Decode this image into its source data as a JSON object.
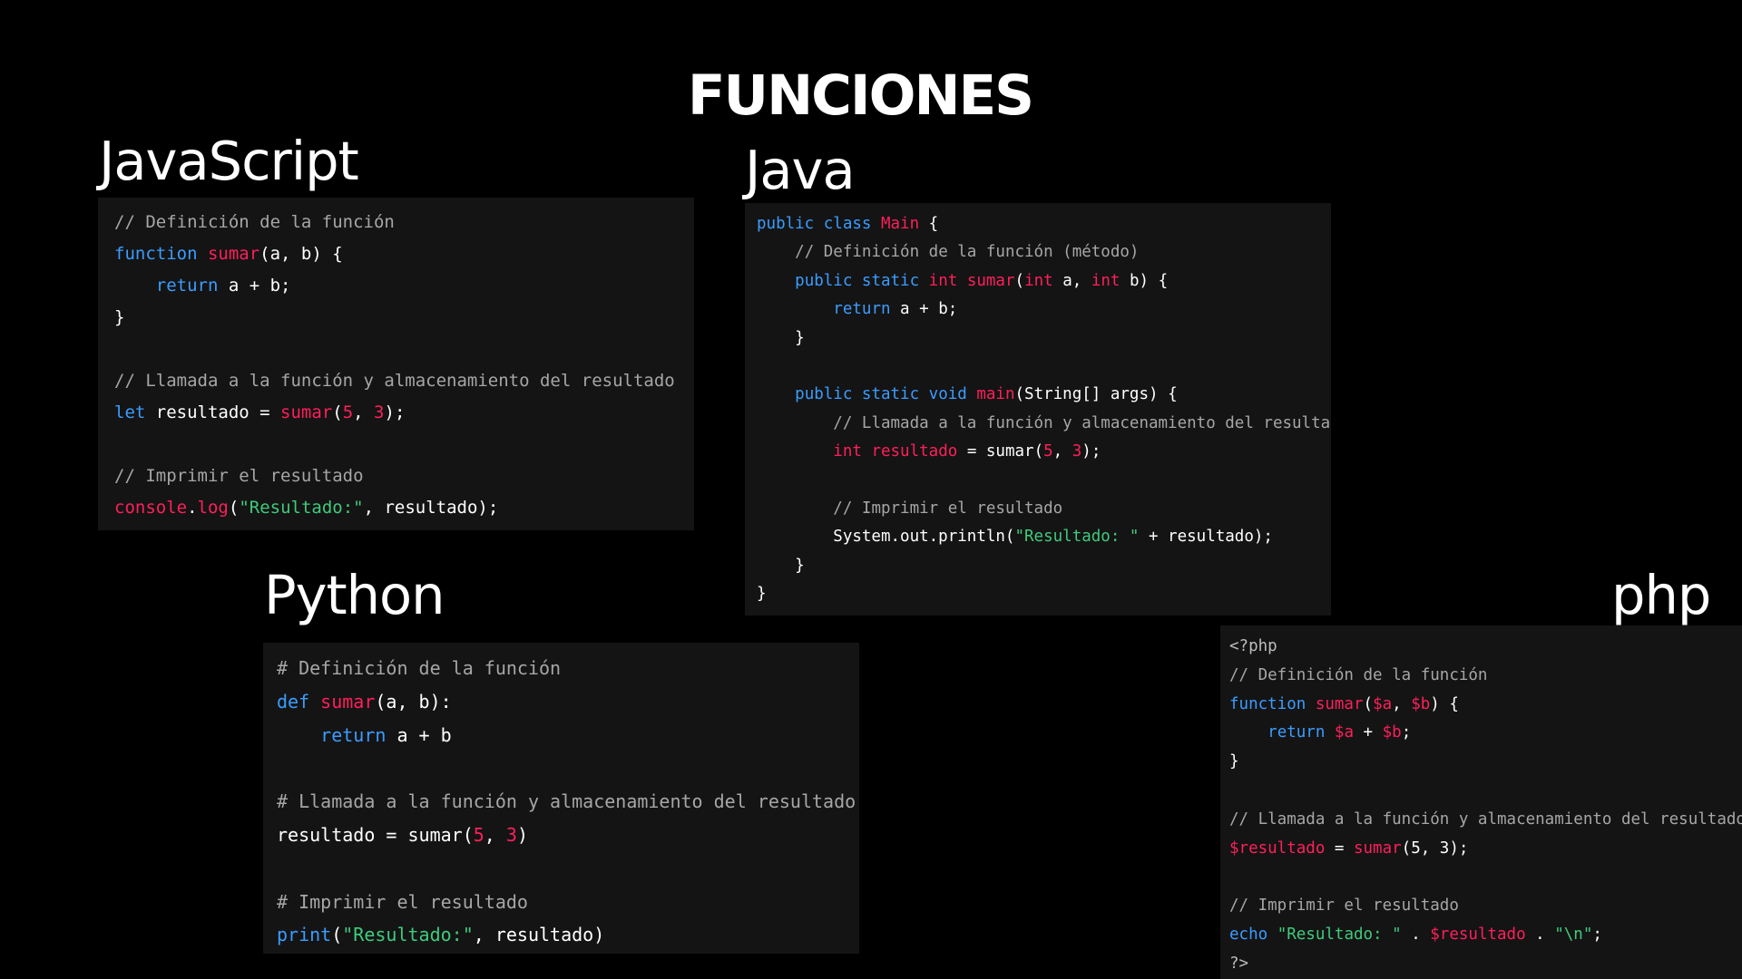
{
  "slide": {
    "title": "FUNCIONES"
  },
  "colors": {
    "background": "#000000",
    "code_background": "#141414",
    "comment": "#a6a6a6",
    "keyword": "#3b9cff",
    "function_name": "#ff1f5a",
    "string": "#3ecb7c",
    "text": "#ffffff"
  },
  "blocks": {
    "javascript": {
      "heading": "JavaScript",
      "lines": [
        [
          [
            "cm",
            "// Definición de la función"
          ]
        ],
        [
          [
            "kw",
            "function "
          ],
          [
            "fn",
            "sumar"
          ],
          [
            "pl",
            "(a, b) {"
          ]
        ],
        [
          [
            "pl",
            "    "
          ],
          [
            "kw",
            "return"
          ],
          [
            "pl",
            " a + b;"
          ]
        ],
        [
          [
            "pl",
            "}"
          ]
        ],
        [],
        [
          [
            "cm",
            "// Llamada a la función y almacenamiento del resultado"
          ]
        ],
        [
          [
            "kw",
            "let"
          ],
          [
            "pl",
            " resultado = "
          ],
          [
            "fn",
            "sumar"
          ],
          [
            "pl",
            "("
          ],
          [
            "nu",
            "5"
          ],
          [
            "pl",
            ", "
          ],
          [
            "nu",
            "3"
          ],
          [
            "pl",
            ");"
          ]
        ],
        [],
        [
          [
            "cm",
            "// Imprimir el resultado"
          ]
        ],
        [
          [
            "fn",
            "console"
          ],
          [
            "pl",
            "."
          ],
          [
            "fn",
            "log"
          ],
          [
            "pl",
            "("
          ],
          [
            "st",
            "\"Resultado:\""
          ],
          [
            "pl",
            ", resultado);"
          ]
        ]
      ]
    },
    "java": {
      "heading": "Java",
      "lines": [
        [
          [
            "kw",
            "public class "
          ],
          [
            "fn",
            "Main"
          ],
          [
            "pl",
            " {"
          ]
        ],
        [
          [
            "pl",
            "    "
          ],
          [
            "cm",
            "// Definición de la función (método)"
          ]
        ],
        [
          [
            "pl",
            "    "
          ],
          [
            "kw",
            "public static "
          ],
          [
            "ty",
            "int "
          ],
          [
            "fn",
            "sumar"
          ],
          [
            "pl",
            "("
          ],
          [
            "ty",
            "int"
          ],
          [
            "pl",
            " a, "
          ],
          [
            "ty",
            "int"
          ],
          [
            "pl",
            " b) {"
          ]
        ],
        [
          [
            "pl",
            "        "
          ],
          [
            "kw",
            "return"
          ],
          [
            "pl",
            " a + b;"
          ]
        ],
        [
          [
            "pl",
            "    }"
          ]
        ],
        [],
        [
          [
            "pl",
            "    "
          ],
          [
            "kw",
            "public static void "
          ],
          [
            "fn",
            "main"
          ],
          [
            "pl",
            "(String[] args) {"
          ]
        ],
        [
          [
            "pl",
            "        "
          ],
          [
            "cm",
            "// Llamada a la función y almacenamiento del resultado"
          ]
        ],
        [
          [
            "pl",
            "        "
          ],
          [
            "ty",
            "int "
          ],
          [
            "va",
            "resultado"
          ],
          [
            "pl",
            " = sumar("
          ],
          [
            "nu",
            "5"
          ],
          [
            "pl",
            ", "
          ],
          [
            "nu",
            "3"
          ],
          [
            "pl",
            ");"
          ]
        ],
        [],
        [
          [
            "pl",
            "        "
          ],
          [
            "cm",
            "// Imprimir el resultado"
          ]
        ],
        [
          [
            "pl",
            "        System.out.println("
          ],
          [
            "st",
            "\"Resultado: \""
          ],
          [
            "pl",
            " + resultado);"
          ]
        ],
        [
          [
            "pl",
            "    }"
          ]
        ],
        [
          [
            "pl",
            "}"
          ]
        ]
      ]
    },
    "python": {
      "heading": "Python",
      "lines": [
        [
          [
            "cm",
            "# Definición de la función"
          ]
        ],
        [
          [
            "kw",
            "def "
          ],
          [
            "fn",
            "sumar"
          ],
          [
            "pl",
            "(a, b):"
          ]
        ],
        [
          [
            "pl",
            "    "
          ],
          [
            "kw",
            "return"
          ],
          [
            "pl",
            " a + b"
          ]
        ],
        [],
        [
          [
            "cm",
            "# Llamada a la función y almacenamiento del resultado"
          ]
        ],
        [
          [
            "pl",
            "resultado = sumar("
          ],
          [
            "nu",
            "5"
          ],
          [
            "pl",
            ", "
          ],
          [
            "nu",
            "3"
          ],
          [
            "pl",
            ")"
          ]
        ],
        [],
        [
          [
            "cm",
            "# Imprimir el resultado"
          ]
        ],
        [
          [
            "kw",
            "print"
          ],
          [
            "pl",
            "("
          ],
          [
            "st",
            "\"Resultado:\""
          ],
          [
            "pl",
            ", resultado)"
          ]
        ]
      ]
    },
    "php": {
      "heading": "php",
      "lines": [
        [
          [
            "dim",
            "<?php"
          ]
        ],
        [
          [
            "cm",
            "// Definición de la función"
          ]
        ],
        [
          [
            "kw",
            "function "
          ],
          [
            "fn",
            "sumar"
          ],
          [
            "pl",
            "("
          ],
          [
            "va",
            "$a"
          ],
          [
            "pl",
            ", "
          ],
          [
            "va",
            "$b"
          ],
          [
            "pl",
            ") {"
          ]
        ],
        [
          [
            "pl",
            "    "
          ],
          [
            "kw",
            "return "
          ],
          [
            "va",
            "$a"
          ],
          [
            "pl",
            " + "
          ],
          [
            "va",
            "$b"
          ],
          [
            "pl",
            ";"
          ]
        ],
        [
          [
            "pl",
            "}"
          ]
        ],
        [],
        [
          [
            "cm",
            "// Llamada a la función y almacenamiento del resultado"
          ]
        ],
        [
          [
            "va",
            "$resultado"
          ],
          [
            "pl",
            " = "
          ],
          [
            "fn",
            "sumar"
          ],
          [
            "pl",
            "(5, 3);"
          ]
        ],
        [],
        [
          [
            "cm",
            "// Imprimir el resultado"
          ]
        ],
        [
          [
            "kw",
            "echo "
          ],
          [
            "st",
            "\"Resultado: \""
          ],
          [
            "pl",
            " . "
          ],
          [
            "va",
            "$resultado"
          ],
          [
            "pl",
            " . "
          ],
          [
            "st",
            "\"\\n\""
          ],
          [
            "pl",
            ";"
          ]
        ],
        [
          [
            "dim",
            "?>"
          ]
        ]
      ]
    }
  }
}
